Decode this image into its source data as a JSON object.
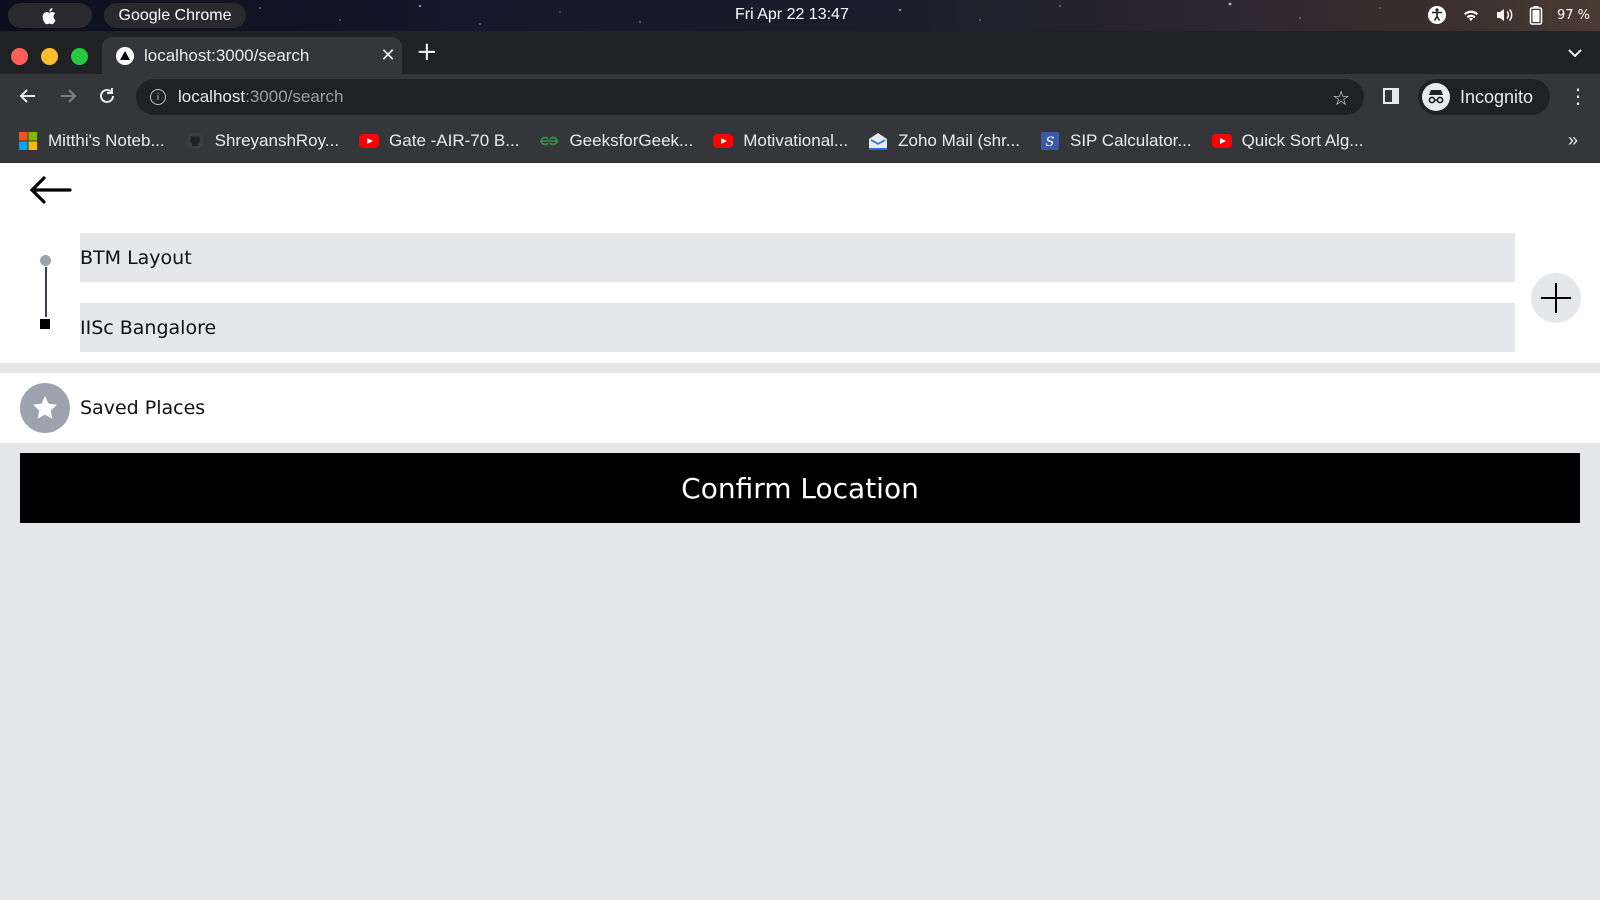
{
  "os": {
    "app_name": "Google Chrome",
    "clock": "Fri Apr 22  13:47",
    "battery": "97 %"
  },
  "browser": {
    "tab_title": "localhost:3000/search",
    "url_host": "localhost",
    "url_path": ":3000/search",
    "profile_label": "Incognito",
    "bookmarks": [
      {
        "label": "Mitthi's Noteb...",
        "icon": "microsoft-icon"
      },
      {
        "label": "ShreyanshRoy...",
        "icon": "github-icon"
      },
      {
        "label": "Gate -AIR-70 B...",
        "icon": "youtube-icon"
      },
      {
        "label": "GeeksforGeek...",
        "icon": "gfg-icon"
      },
      {
        "label": "Motivational...",
        "icon": "youtube-icon"
      },
      {
        "label": "Zoho Mail (shr...",
        "icon": "zoho-mail-icon"
      },
      {
        "label": "SIP Calculator...",
        "icon": "sip-icon"
      },
      {
        "label": "Quick Sort Alg...",
        "icon": "youtube-icon"
      }
    ]
  },
  "search": {
    "pickup": "BTM Layout",
    "dropoff": "IISc Bangalore",
    "saved_places_label": "Saved Places",
    "confirm_label": "Confirm Location"
  },
  "colors": {
    "page_bg": "#e5e7eb",
    "field_bg": "#e5e7eb",
    "confirm_bg": "#000000",
    "icon_gray": "#9ca3af"
  }
}
